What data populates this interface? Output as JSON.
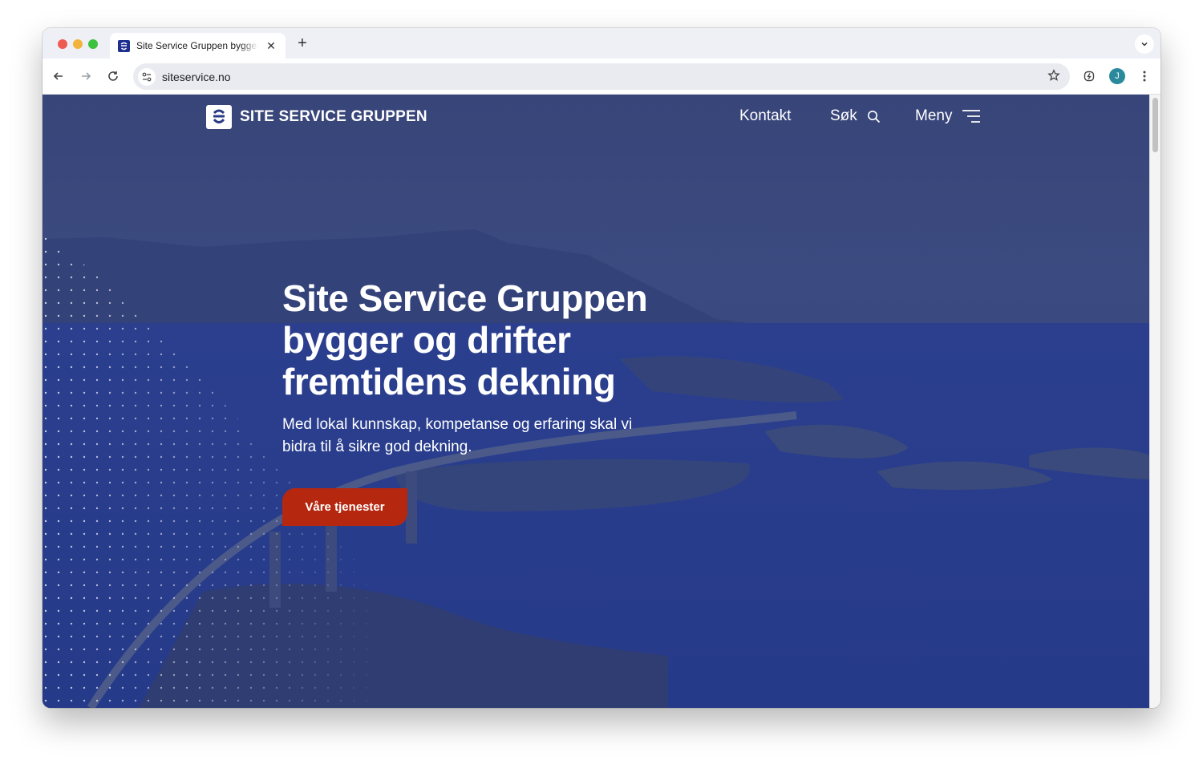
{
  "browser": {
    "tab": {
      "title": "Site Service Gruppen bygger og drifter fremtidens dekning",
      "close_glyph": "✕"
    },
    "new_tab_glyph": "+",
    "tab_dropdown_glyph": "⌄",
    "address_bar": {
      "url": "siteservice.no"
    },
    "avatar_initial": "J",
    "icons": [
      "back-arrow-icon",
      "forward-arrow-icon",
      "reload-icon",
      "site-info-icon",
      "bookmark-star-icon",
      "extension-icon",
      "more-menu-icon"
    ]
  },
  "site": {
    "logo_text": "SITE SERVICE GRUPPEN",
    "nav": {
      "contact": "Kontakt",
      "search": "Søk",
      "menu": "Meny"
    },
    "hero": {
      "title_line_1": "Site Service Gruppen",
      "title_line_2": "bygger og drifter",
      "title_line_3": "fremtidens dekning",
      "subtitle": "Med lokal kunnskap, kompetanse og erfaring skal vi bidra til å sikre god dekning.",
      "cta_label": "Våre tjenester"
    }
  },
  "colors": {
    "overlay": "#2a3a84",
    "cta": "#b5280f",
    "text": "#ffffff"
  }
}
